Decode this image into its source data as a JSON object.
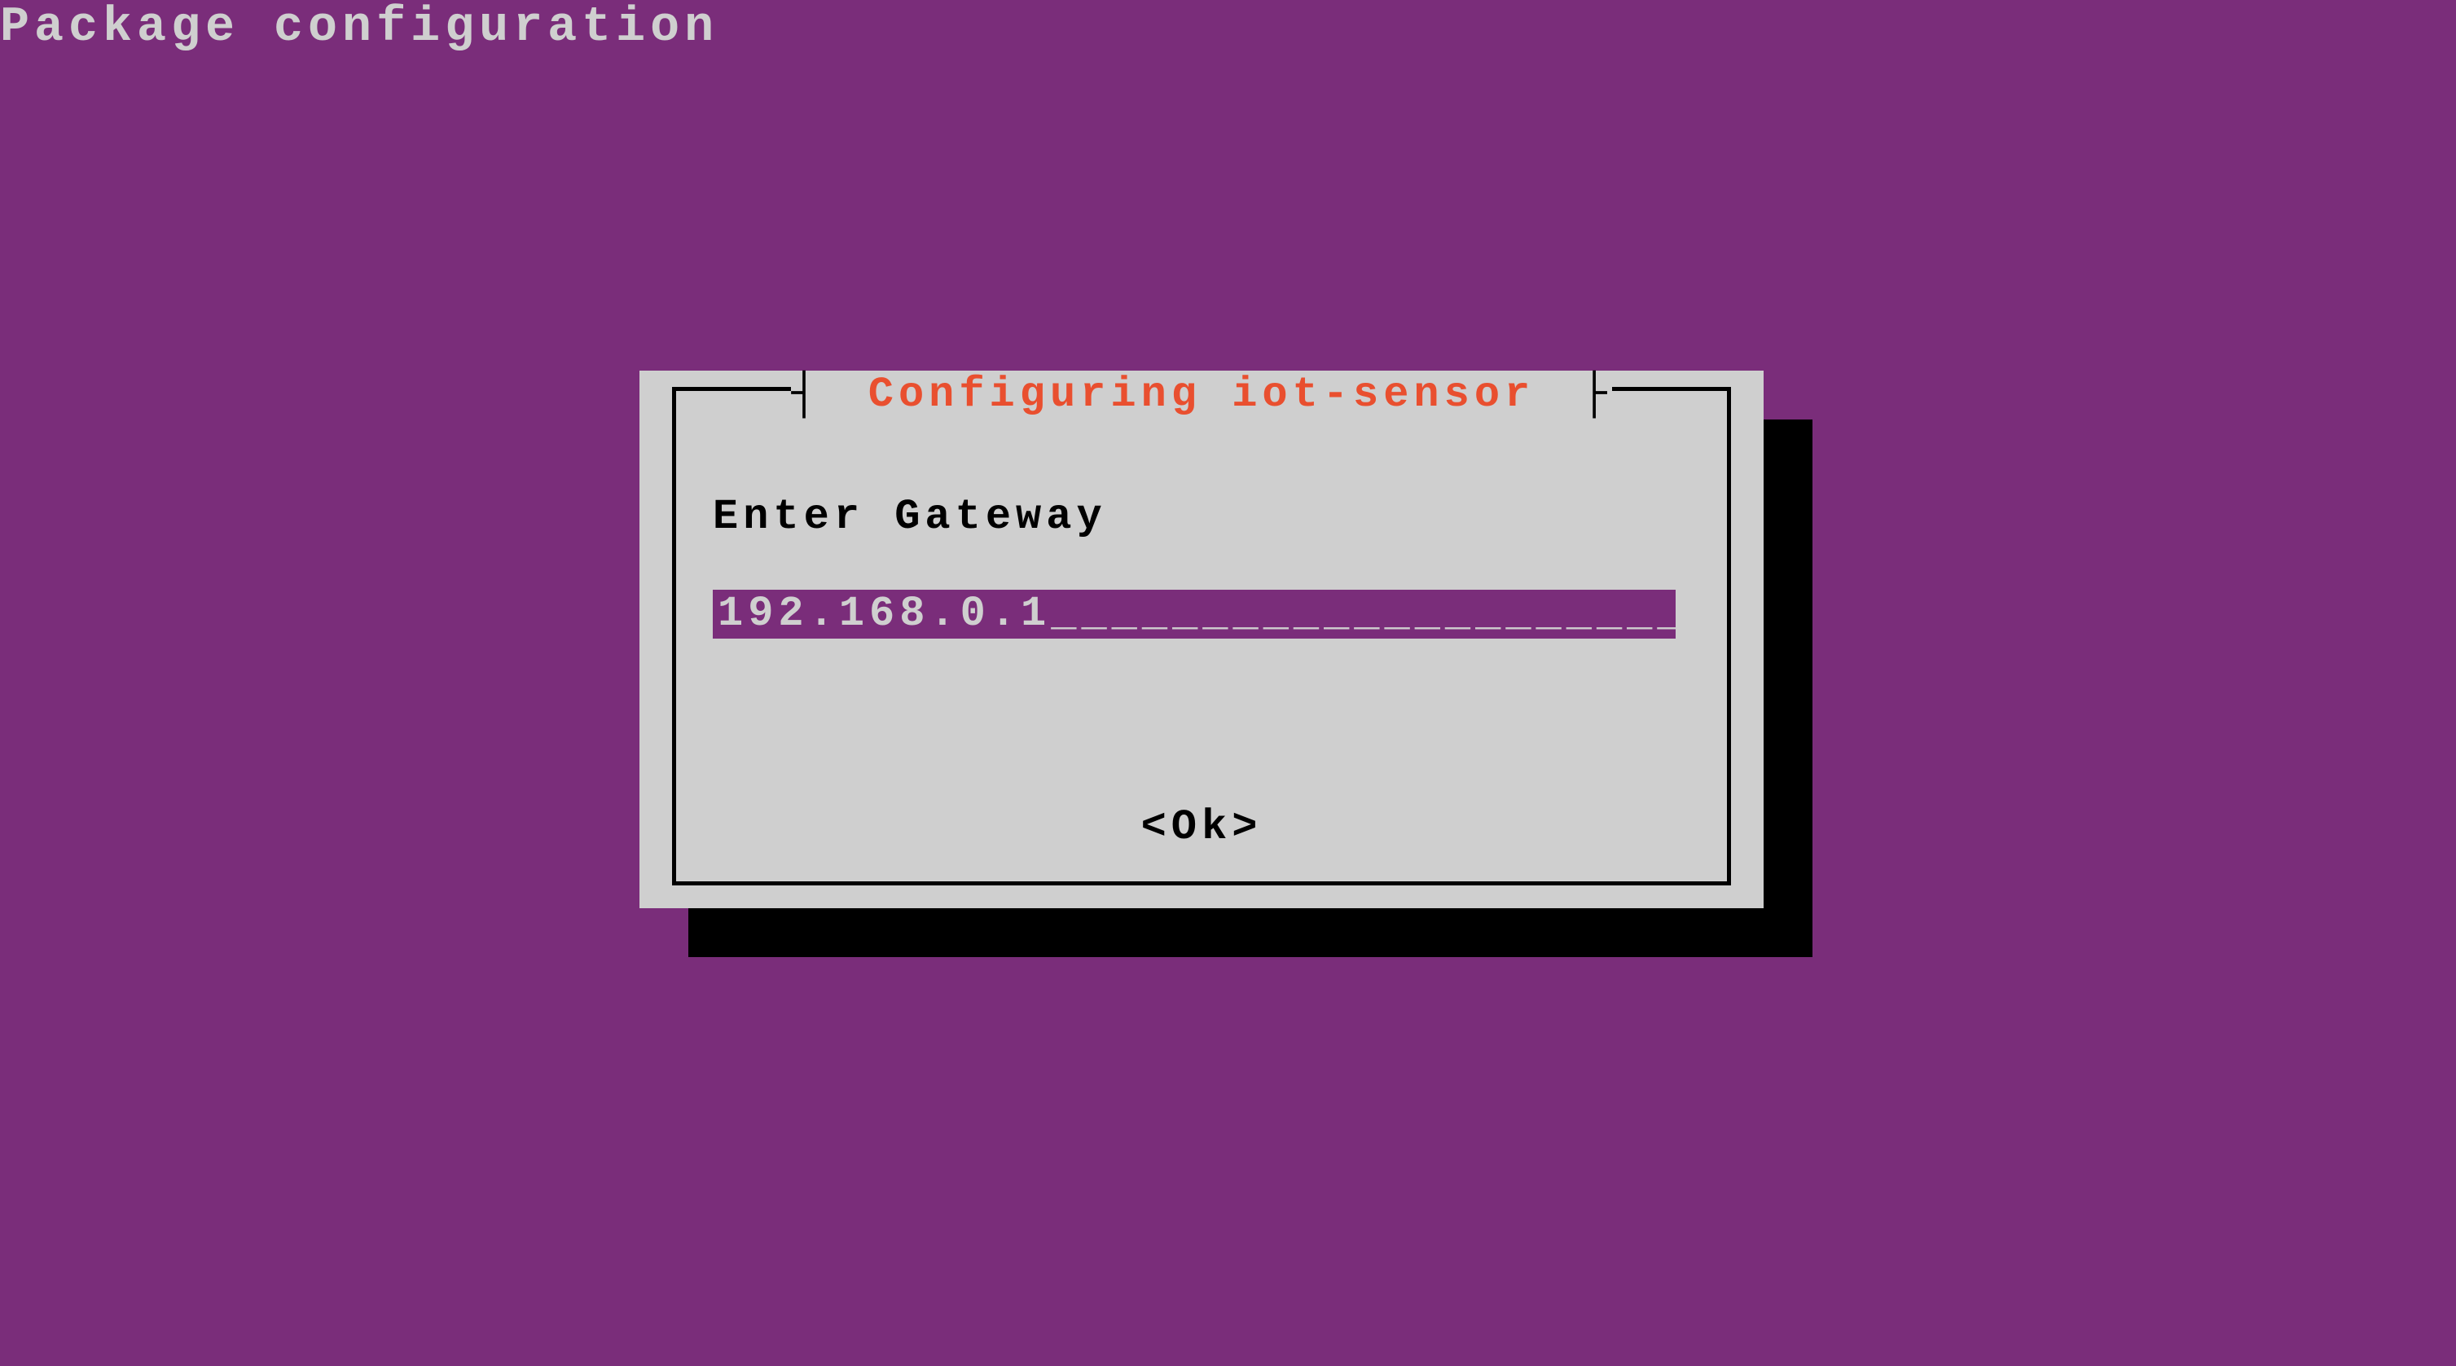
{
  "screen": {
    "title": "Package configuration"
  },
  "dialog": {
    "title_left_bracket": "┤",
    "title": " Configuring iot-sensor ",
    "title_right_bracket": "├",
    "prompt": "Enter Gateway",
    "input_value": "192.168.0.1",
    "input_fill_char": "_",
    "input_width_chars": 33,
    "ok_label": "<Ok>"
  },
  "colors": {
    "background": "#7a2d7a",
    "panel": "#cfcfcf",
    "shadow": "#000000",
    "title_text": "#e94f2f",
    "text": "#000000",
    "screen_title_text": "#cfcfcf"
  }
}
